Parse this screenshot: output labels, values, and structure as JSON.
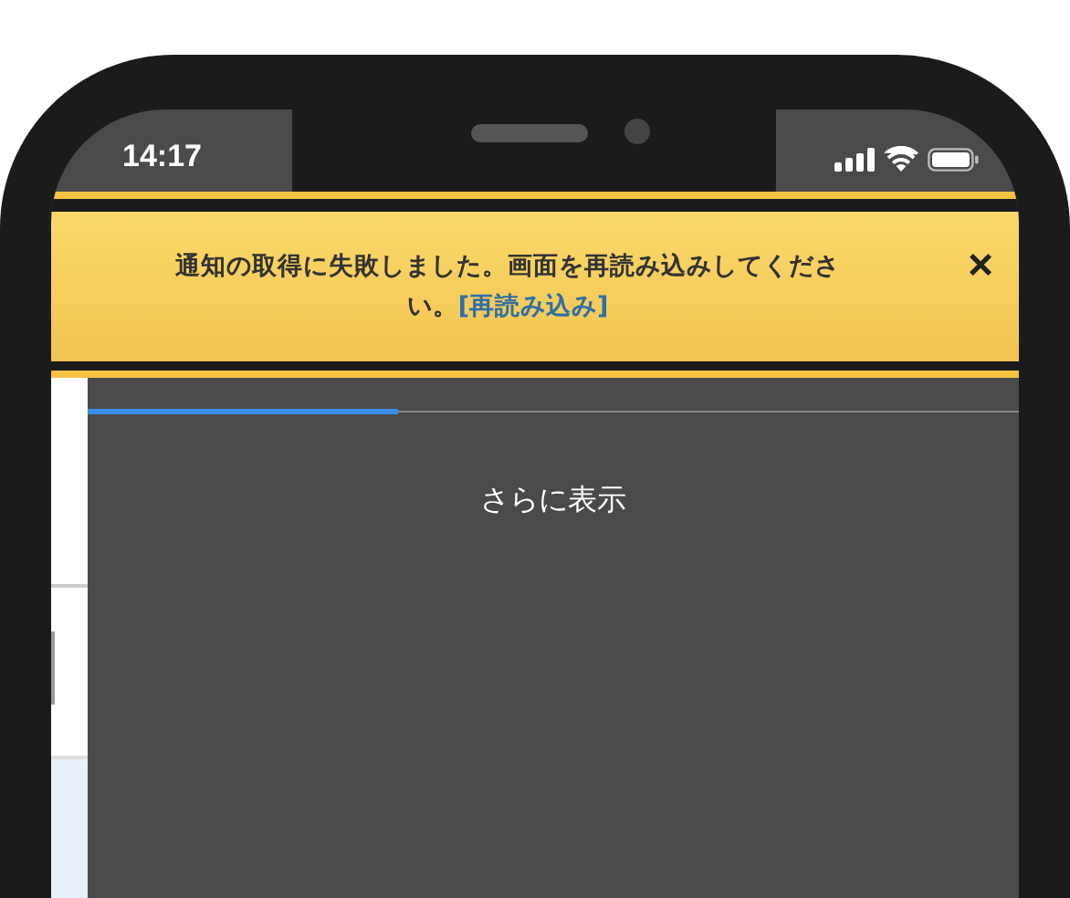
{
  "status_bar": {
    "time": "14:17"
  },
  "banner": {
    "message": "通知の取得に失敗しました。画面を再読み込みしてください。",
    "link": "[再読み込み]",
    "close": "×"
  },
  "tabs": [
    {
      "selected": true
    },
    {
      "selected": false
    },
    {
      "selected": false
    }
  ],
  "more_button": "さらに表示"
}
